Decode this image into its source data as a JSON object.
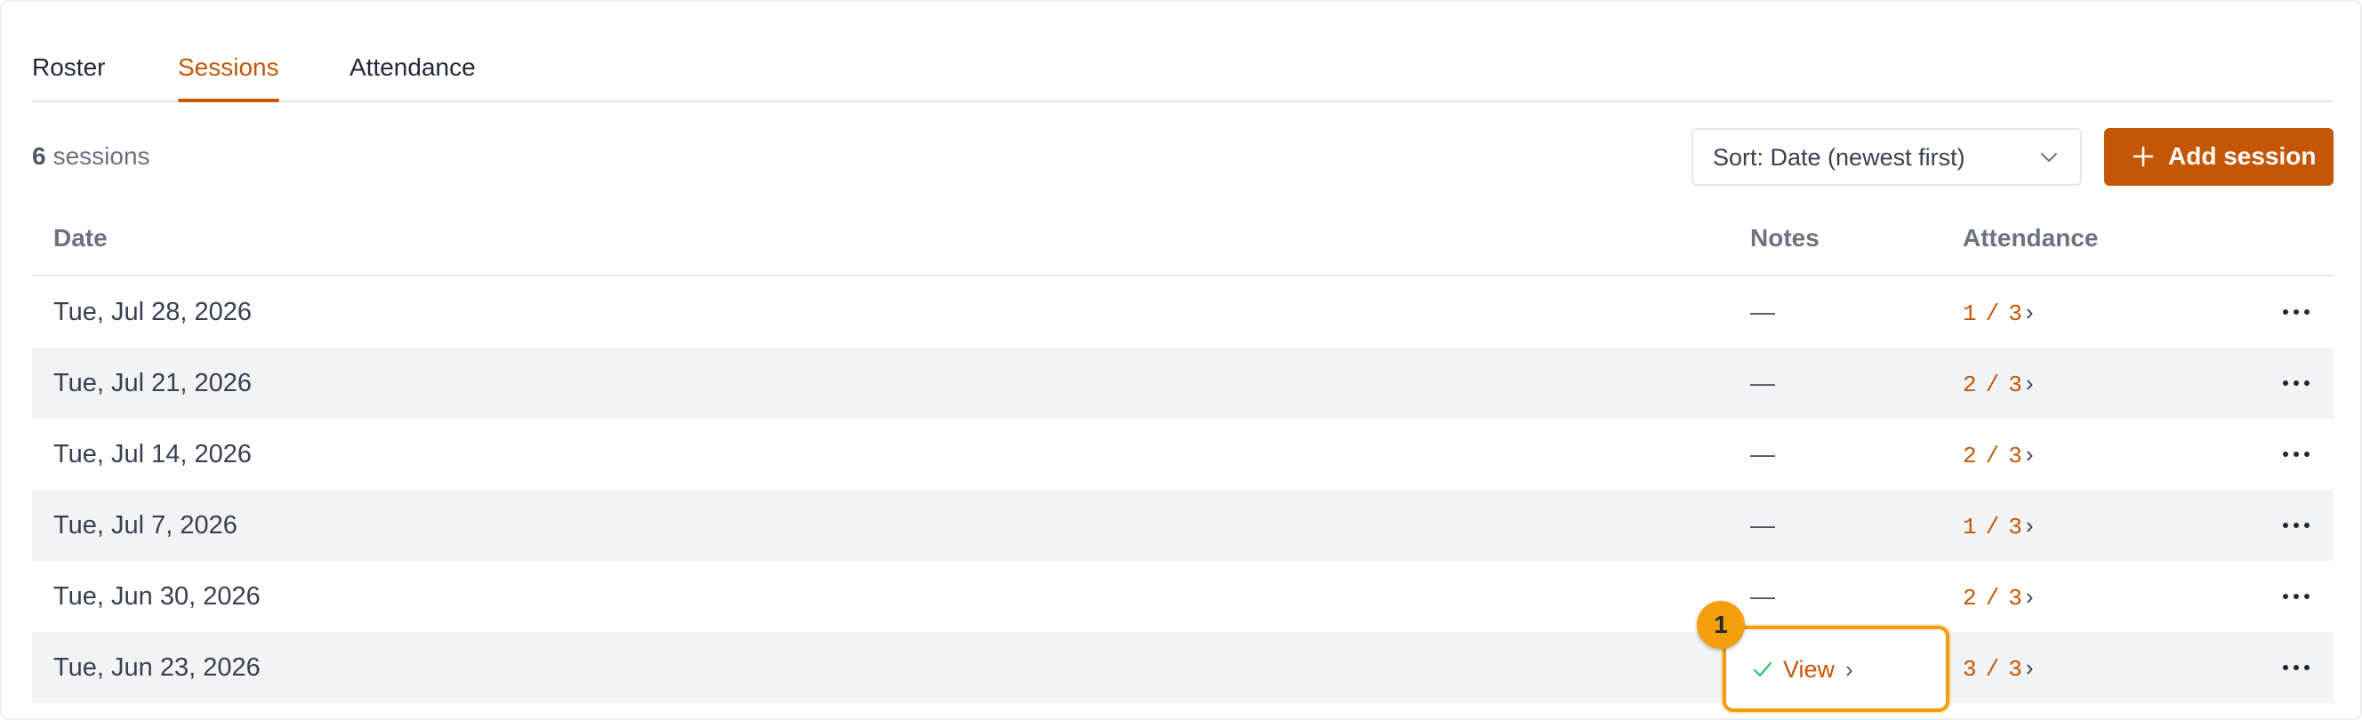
{
  "tabs": [
    {
      "label": "Roster",
      "active": false
    },
    {
      "label": "Sessions",
      "active": true
    },
    {
      "label": "Attendance",
      "active": false
    }
  ],
  "toolbar": {
    "count_value": "6",
    "count_label": "sessions",
    "sort_label": "Sort: Date (newest first)",
    "add_label": "Add session"
  },
  "table": {
    "headers": {
      "date": "Date",
      "notes": "Notes",
      "attendance": "Attendance"
    },
    "rows": [
      {
        "date": "Tue, Jul 28, 2026",
        "notes": "—",
        "present": "1",
        "total": "3"
      },
      {
        "date": "Tue, Jul 21, 2026",
        "notes": "—",
        "present": "2",
        "total": "3"
      },
      {
        "date": "Tue, Jul 14, 2026",
        "notes": "—",
        "present": "2",
        "total": "3"
      },
      {
        "date": "Tue, Jul 7, 2026",
        "notes": "—",
        "present": "1",
        "total": "3"
      },
      {
        "date": "Tue, Jun 30, 2026",
        "notes": "—",
        "present": "2",
        "total": "3"
      },
      {
        "date": "Tue, Jun 23, 2026",
        "notes": "",
        "present": "3",
        "total": "3"
      }
    ],
    "att_sep": "/",
    "att_arrow": "›"
  },
  "highlight": {
    "marker": "1",
    "view_label": "View",
    "view_arrow": "›"
  },
  "colors": {
    "accent": "#c45606",
    "highlight": "#f59e0b",
    "check": "#22c55e",
    "row_alt": "#f2f3f5"
  },
  "icons": {
    "sort": "chevron-down-icon",
    "add": "plus-icon",
    "view": "check-icon",
    "row_actions": "more-horizontal-icon"
  }
}
